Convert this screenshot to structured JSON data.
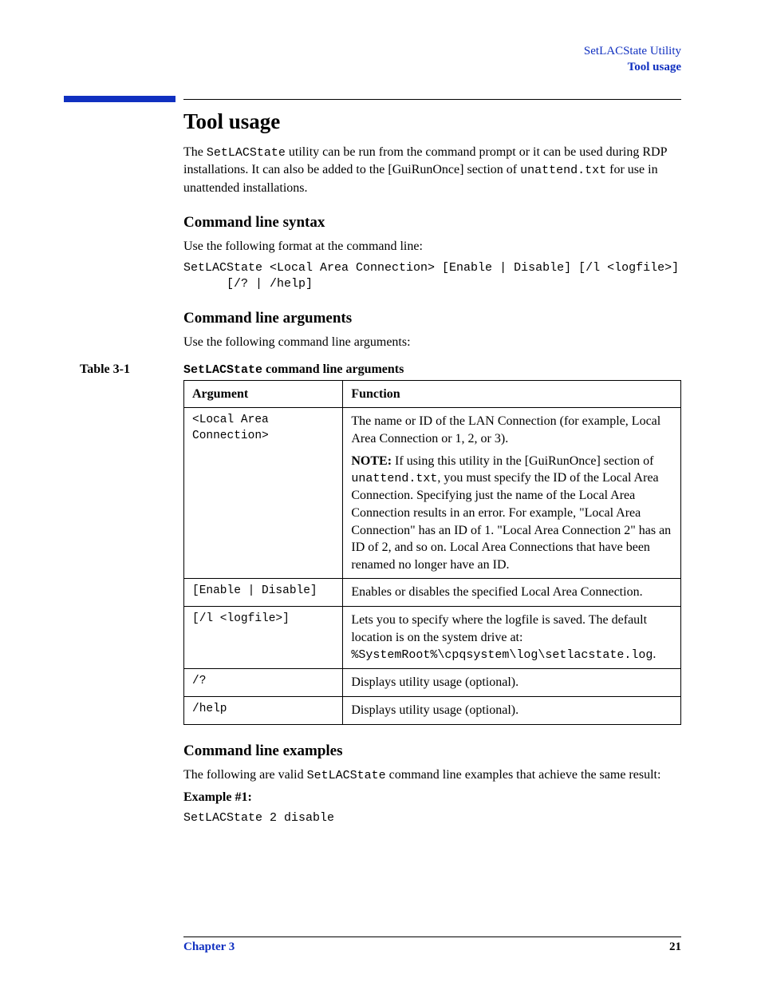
{
  "header": {
    "line1": "SetLACState Utility",
    "line2": "Tool usage"
  },
  "main": {
    "title": "Tool usage",
    "intro_p1_a": "The ",
    "intro_p1_code1": "SetLACState",
    "intro_p1_b": " utility can be run from the command prompt or it can be used during RDP installations. It can also be added to the [GuiRunOnce] section of ",
    "intro_p1_code2": "unattend.txt",
    "intro_p1_c": " for use in unattended installations.",
    "syntax": {
      "heading": "Command line syntax",
      "lead": "Use the following format at the command line:",
      "code": "SetLACState <Local Area Connection> [Enable | Disable] [/l <logfile>]\n      [/? | /help]"
    },
    "args": {
      "heading": "Command line arguments",
      "lead": "Use the following command line arguments:",
      "table_label": "Table 3-1",
      "table_title_code": "SetLACState",
      "table_title_rest": " command line arguments",
      "col1": "Argument",
      "col2": "Function",
      "rows": [
        {
          "arg": "<Local Area Connection>",
          "fn_main": "The name or ID of the LAN Connection (for example, Local Area Connection or 1, 2, or 3).",
          "note_label": "NOTE:",
          "note_a": "  If using this utility in the [GuiRunOnce] section of ",
          "note_code": "unattend.txt",
          "note_b": ", you must specify the ID of the Local Area Connection. Specifying just the name of the Local Area Connection results in an error. For example, \"Local Area Connection\" has an ID of 1. \"Local Area Connection 2\" has an ID of 2, and so on. Local Area Connections that have been renamed no longer have an ID."
        },
        {
          "arg": "[Enable | Disable]",
          "fn": "Enables or disables the specified Local Area Connection."
        },
        {
          "arg": "[/l <logfile>]",
          "fn_a": "Lets you to specify where the logfile is saved. The default location is on the system drive at: ",
          "fn_code": "%SystemRoot%\\cpqsystem\\log\\setlacstate.log",
          "fn_b": "."
        },
        {
          "arg": "/?",
          "fn": "Displays utility usage (optional)."
        },
        {
          "arg": "/help",
          "fn": "Displays utility usage (optional)."
        }
      ]
    },
    "examples": {
      "heading": "Command line examples",
      "lead_a": "The following are valid ",
      "lead_code": "SetLACState",
      "lead_b": " command line examples that achieve the same result:",
      "ex1_label": "Example #1:",
      "ex1_code": "SetLACState 2 disable"
    }
  },
  "footer": {
    "chapter": "Chapter 3",
    "page": "21"
  }
}
